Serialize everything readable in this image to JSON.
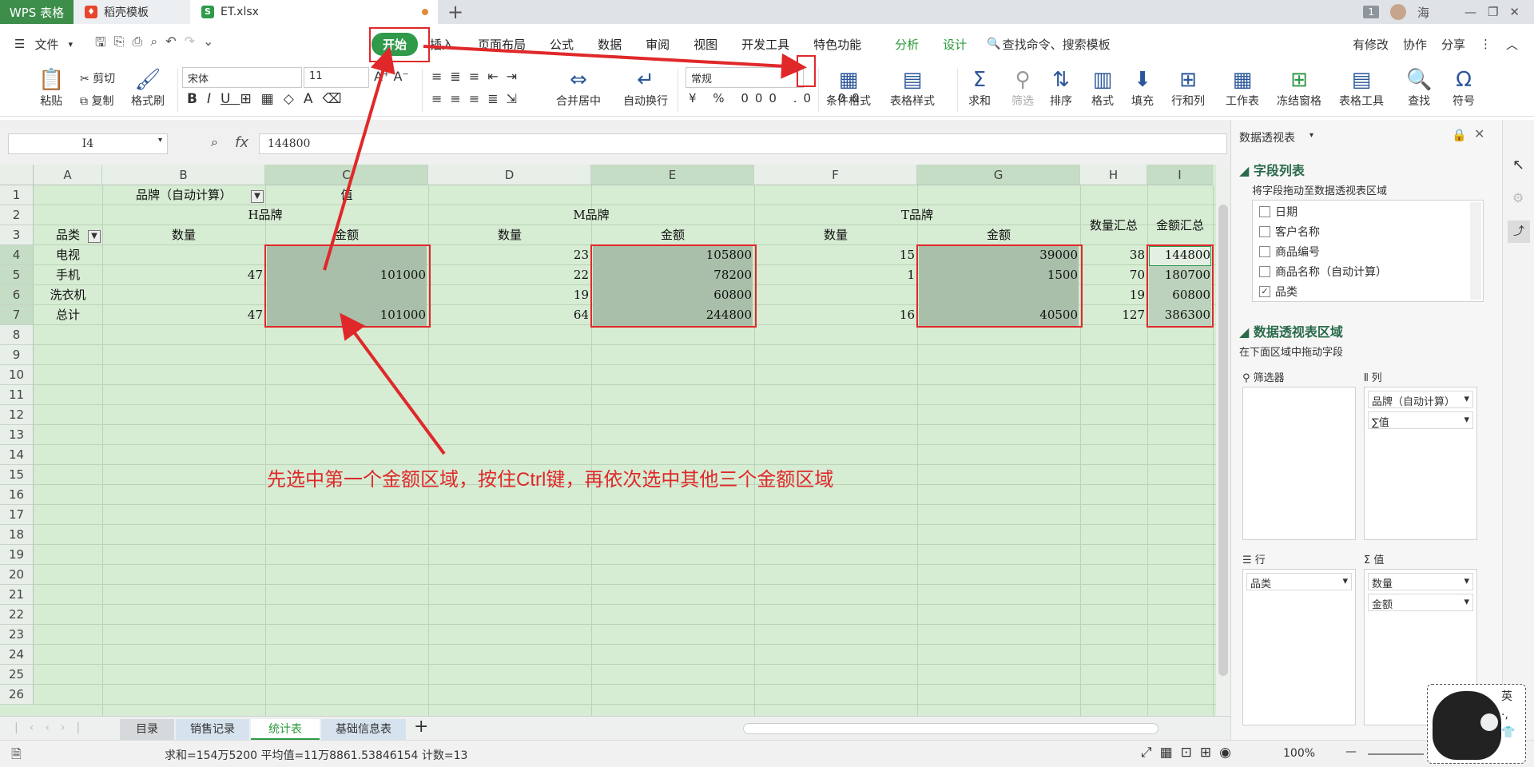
{
  "tabs": {
    "wps": "WPS 表格",
    "template": "稻壳模板",
    "file": "ET.xlsx",
    "plus": "+",
    "badge": "1",
    "user": "海"
  },
  "menu": {
    "file": "文件",
    "items": [
      "开始",
      "插入",
      "页面布局",
      "公式",
      "数据",
      "审阅",
      "视图",
      "开发工具",
      "特色功能"
    ],
    "green_items": [
      "分析",
      "设计"
    ],
    "search": "查找命令、搜索模板",
    "right": [
      "有修改",
      "协作",
      "分享"
    ]
  },
  "ribbon": {
    "paste": "粘贴",
    "cut": "剪切",
    "copy": "复制",
    "format_brush": "格式刷",
    "font_name": "宋体",
    "font_size": "11",
    "merge": "合并居中",
    "wrap": "自动换行",
    "num_format": "常规",
    "cond_format": "条件格式",
    "table_style": "表格样式",
    "sum": "求和",
    "filter": "筛选",
    "sort": "排序",
    "format": "格式",
    "fill": "填充",
    "rowcol": "行和列",
    "worksheet": "工作表",
    "freeze": "冻结窗格",
    "table_tools": "表格工具",
    "find": "查找",
    "symbol": "符号"
  },
  "formula": {
    "cell_ref": "I4",
    "fx": "fx",
    "value": "144800"
  },
  "columns": [
    "A",
    "B",
    "C",
    "D",
    "E",
    "F",
    "G",
    "H",
    "I"
  ],
  "rows": [
    "1",
    "2",
    "3",
    "4",
    "5",
    "6",
    "7",
    "8",
    "9",
    "10",
    "11",
    "12",
    "13",
    "14",
    "15",
    "16",
    "17",
    "18",
    "19",
    "20",
    "21",
    "22",
    "23",
    "24",
    "25",
    "26"
  ],
  "pivot": {
    "b1": "品牌（自动计算）",
    "c1": "值",
    "h_brand": "H品牌",
    "m_brand": "M品牌",
    "t_brand": "T品牌",
    "qty_total": "数量汇总",
    "amt_total": "金额汇总",
    "category": "品类",
    "qty": "数量",
    "amount": "金额",
    "body": [
      {
        "label": "电视",
        "b": "",
        "c": "",
        "d": "23",
        "e": "105800",
        "f": "15",
        "g": "39000",
        "h": "38",
        "i": "144800"
      },
      {
        "label": "手机",
        "b": "47",
        "c": "101000",
        "d": "22",
        "e": "78200",
        "f": "1",
        "g": "1500",
        "h": "70",
        "i": "180700"
      },
      {
        "label": "洗衣机",
        "b": "",
        "c": "",
        "d": "19",
        "e": "60800",
        "f": "",
        "g": "",
        "h": "19",
        "i": "60800"
      },
      {
        "label": "总计",
        "b": "47",
        "c": "101000",
        "d": "64",
        "e": "244800",
        "f": "16",
        "g": "40500",
        "h": "127",
        "i": "386300"
      }
    ]
  },
  "annotation": "先选中第一个金额区域，按住Ctrl键，再依次选中其他三个金额区域",
  "sheets": [
    "目录",
    "销售记录",
    "统计表",
    "基础信息表"
  ],
  "active_sheet": "统计表",
  "status": {
    "text": "求和=154万5200  平均值=11万8861.53846154  计数=13",
    "zoom": "100%"
  },
  "pane": {
    "title": "数据透视表",
    "field_list": "字段列表",
    "drag_hint": "将字段拖动至数据透视表区域",
    "fields": [
      {
        "name": "日期",
        "checked": false
      },
      {
        "name": "客户名称",
        "checked": false
      },
      {
        "name": "商品编号",
        "checked": false
      },
      {
        "name": "商品名称（自动计算）",
        "checked": false
      },
      {
        "name": "品类",
        "checked": true
      }
    ],
    "area_title": "数据透视表区域",
    "area_hint": "在下面区域中拖动字段",
    "filter": "筛选器",
    "columns": "列",
    "rows": "行",
    "values": "值",
    "col_items": [
      "品牌（自动计算）",
      "∑值"
    ],
    "row_items": [
      "品类"
    ],
    "val_items": [
      "数量",
      "金额"
    ]
  },
  "ime": {
    "lang": "英"
  },
  "colors": {
    "accent": "#2f9a4a",
    "annotation": "#e0282a",
    "grid": "#d6ecd3"
  }
}
